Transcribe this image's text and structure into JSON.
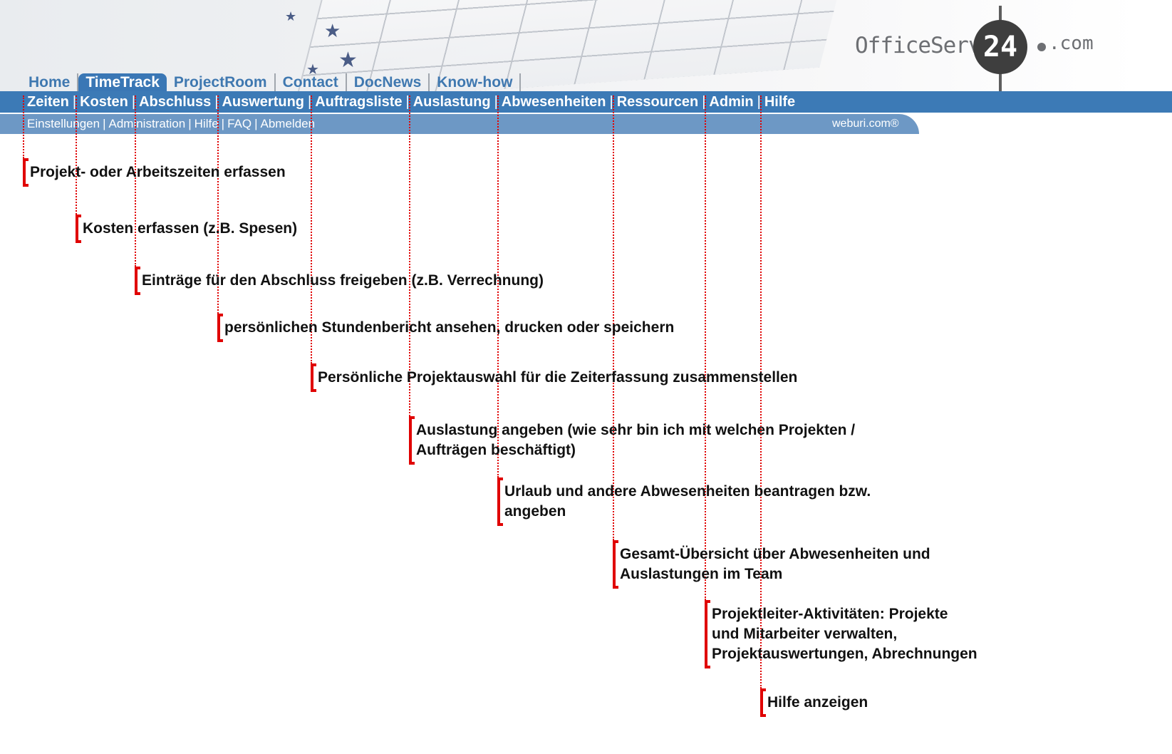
{
  "logo": {
    "left_text": "OfficeService",
    "badge_text": "24",
    "right_text": ".com"
  },
  "tabs": [
    {
      "label": "Home",
      "active": false
    },
    {
      "label": "TimeTrack",
      "active": true
    },
    {
      "label": "ProjectRoom",
      "active": false
    },
    {
      "label": "Contact",
      "active": false
    },
    {
      "label": "DocNews",
      "active": false
    },
    {
      "label": "Know-how",
      "active": false
    }
  ],
  "primary_nav": [
    "Zeiten",
    "Kosten",
    "Abschluss",
    "Auswertung",
    "Auftragsliste",
    "Auslastung",
    "Abwesenheiten",
    "Ressourcen",
    "Admin",
    "Hilfe"
  ],
  "secondary_nav": [
    "Einstellungen",
    "Administration",
    "Hilfe",
    "FAQ",
    "Abmelden"
  ],
  "separator": "|",
  "brand_footer": "weburi.com®",
  "annotations": [
    {
      "target": "Zeiten",
      "lines": [
        "Projekt- oder Arbeitszeiten erfassen"
      ]
    },
    {
      "target": "Kosten",
      "lines": [
        "Kosten erfassen (z.B. Spesen)"
      ]
    },
    {
      "target": "Abschluss",
      "lines": [
        "Einträge für den Abschluss freigeben (z.B. Verrechnung)"
      ]
    },
    {
      "target": "Auswertung",
      "lines": [
        "persönlichen Stundenbericht ansehen, drucken oder speichern"
      ]
    },
    {
      "target": "Auftragsliste",
      "lines": [
        "Persönliche Projektauswahl für die Zeiterfassung zusammenstellen"
      ]
    },
    {
      "target": "Auslastung",
      "lines": [
        "Auslastung angeben (wie sehr bin ich mit welchen Projekten /",
        "Aufträgen beschäftigt)"
      ]
    },
    {
      "target": "Abwesenheiten",
      "lines": [
        "Urlaub und andere Abwesenheiten beantragen bzw.",
        "angeben"
      ]
    },
    {
      "target": "Ressourcen",
      "lines": [
        "Gesamt-Übersicht über Abwesenheiten und",
        "Auslastungen im Team"
      ]
    },
    {
      "target": "Admin",
      "lines": [
        "Projektleiter-Aktivitäten: Projekte",
        "und Mitarbeiter verwalten,",
        "Projektauswertungen, Abrechnungen"
      ]
    },
    {
      "target": "Hilfe",
      "lines": [
        "Hilfe anzeigen"
      ]
    }
  ],
  "colors": {
    "nav_primary": "#3c7ab6",
    "nav_secondary": "#6d98c5",
    "tab_text": "#3f78b0",
    "annotation_red": "#e00000"
  }
}
